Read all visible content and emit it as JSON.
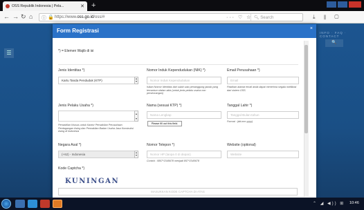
{
  "browser": {
    "tab_title": "OSS Republik Indonesia | Pela...",
    "tab_close": "✕",
    "new_tab": "+",
    "url_prefix": "https://www.",
    "url_domain": "oss.go.id",
    "url_suffix": "/oss/#",
    "page_actions": "··· ♡ ☆",
    "search_placeholder": "Search",
    "right_tools": "⤓ ⫴ ▢"
  },
  "page": {
    "rightnav_text": "INFO · FAQ · CONTACT",
    "right_button": "🔍"
  },
  "modal": {
    "title": "Form Registrasi",
    "close": "×",
    "required_note": "*) = Elemen Wajib di isi",
    "fields": {
      "jenis_identitas": {
        "label": "Jenis Identitas *)",
        "value": "Kartu Tanda Penduduk (KTP)"
      },
      "nik": {
        "label": "Nomor Induk Kependudukan (NIK) *)",
        "placeholder": "Nomor Induk Kependudukan",
        "help": "Isikan Nomor Identitas dari salah satu penanggung jawab yang tercantum dalam akta (untuk jenis pelaku usaha non perseorangan)"
      },
      "email": {
        "label": "Email Perusahaan *)",
        "placeholder": "Email",
        "help": "Pastikan alamat email anda dapat menerima segala notifikasi dari sistem OSS."
      },
      "jenis_pelaku": {
        "label": "Jenis Pelaku Usaha *)",
        "value": "",
        "help": "Perwakilan khusus untuk Kantor Perwakilan Perusahaan Perdagangan Asing dan Perwakilan Badan Usaha Jasa Konstruksi Asing di Indonesia"
      },
      "nama": {
        "label": "Nama (sesuai KTP) *)",
        "placeholder": "Nama Lengkap"
      },
      "tanggal_lahir": {
        "label": "Tanggal Lahir *)",
        "placeholder": "Tanggal-Bulan-tahun",
        "help": "Format : (dd-mm-yyyy)"
      },
      "negara_asal": {
        "label": "Negara Asal *)",
        "value": "(+62) - Indonesia"
      },
      "telepon": {
        "label": "Nomor Telepon *)",
        "placeholder": "Nomor HP (tanpa 0 di depan)",
        "help": "Contoh : 0857*2345678 menjadi 857*2345678"
      },
      "website": {
        "label": "Website (optional)",
        "placeholder": "Website"
      },
      "captcha": {
        "label": "Kode Captcha *)",
        "image_text": "KUNINGAN",
        "placeholder": "MASUKKAN KODE CAPTCHA DI ATAS"
      }
    },
    "validation_tooltip": "Please fill out this field."
  },
  "taskbar": {
    "tray": "⌃ ◢ ◀)) ⊞",
    "time": "10:46"
  }
}
